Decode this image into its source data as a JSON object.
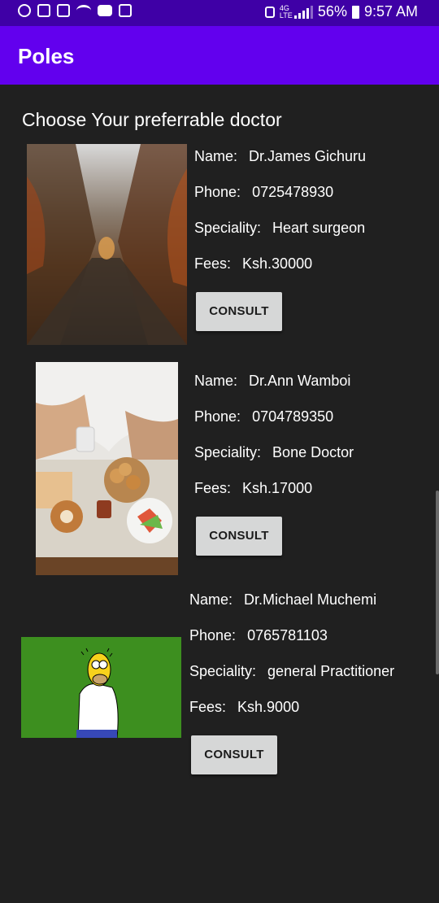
{
  "status_bar": {
    "battery": "56%",
    "time": "9:57 AM",
    "left_icons": [
      "hotspot-icon",
      "checkbox-icon",
      "image-icon",
      "wifi-icon",
      "youtube-icon",
      "laptop-icon"
    ]
  },
  "app": {
    "title": "Poles"
  },
  "heading": "Choose Your preferrable doctor",
  "labels": {
    "name": "Name:",
    "phone": "Phone:",
    "speciality": "Speciality:",
    "fees": "Fees:"
  },
  "doctors": [
    {
      "name": "Dr.James Gichuru",
      "phone": "0725478930",
      "speciality": "Heart surgeon",
      "fees": "Ksh.30000",
      "button": "CONSULT",
      "image": "autumn-forest-path-photo"
    },
    {
      "name": "Dr.Ann Wamboi",
      "phone": "0704789350",
      "speciality": "Bone Doctor",
      "fees": "Ksh.17000",
      "button": "CONSULT",
      "image": "breakfast-tray-photo"
    },
    {
      "name": "Dr.Michael Muchemi",
      "phone": "0765781103",
      "speciality": "general Practitioner",
      "fees": "Ksh.9000",
      "button": "CONSULT",
      "image": "homer-hedge-image"
    }
  ],
  "colors": {
    "toolbar": "#6200ee",
    "status_bar": "#3f00a6",
    "background": "#202020",
    "button": "#d6d7d7"
  }
}
